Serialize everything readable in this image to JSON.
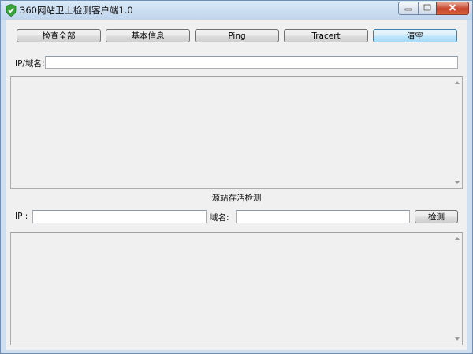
{
  "window": {
    "title": "360网站卫士检测客户端1.0"
  },
  "toolbar": {
    "buttons": [
      {
        "label": "检查全部"
      },
      {
        "label": "基本信息"
      },
      {
        "label": "Ping"
      },
      {
        "label": "Tracert"
      },
      {
        "label": "清空"
      }
    ]
  },
  "target": {
    "label": "IP/域名:",
    "value": ""
  },
  "origin_check": {
    "title": "源站存活检测",
    "ip_label": "IP :",
    "ip_value": "",
    "domain_label": "域名:",
    "domain_value": "",
    "button_label": "检测"
  },
  "icons": {
    "app": "shield-check-icon",
    "minimize": "minimize-icon",
    "maximize": "maximize-icon",
    "close": "close-icon"
  },
  "colors": {
    "close_button": "#c7442a",
    "shield": "#3aa53a",
    "focused_button_border": "#3c7fb1"
  }
}
